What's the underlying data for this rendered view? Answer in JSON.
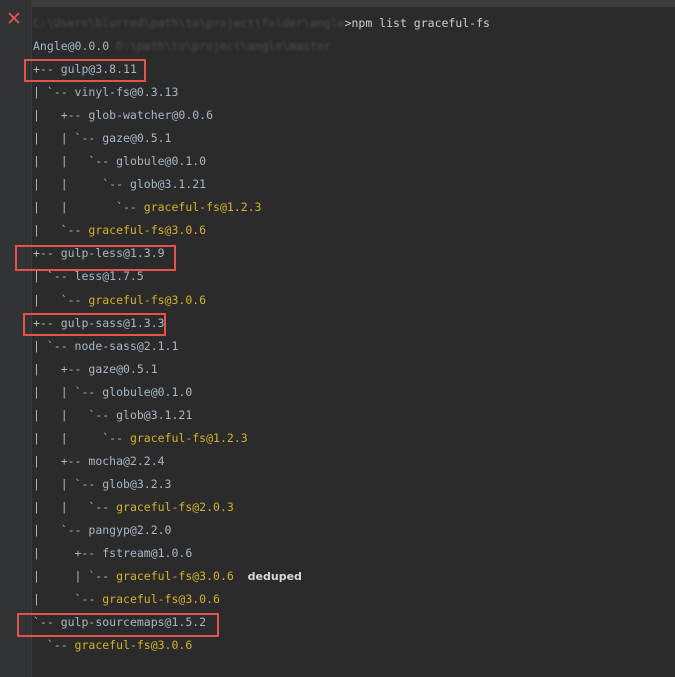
{
  "command": {
    "prompt_blurred": "C:\\Users\\blurred\\path\\to\\project\\folder\\angle",
    "text": ">npm list graceful-fs"
  },
  "root": {
    "package": "Angle@0.0.0",
    "path_blurred": "D:\\path\\to\\project\\angle\\master"
  },
  "tree": [
    {
      "prefix": "+-- ",
      "pkg": "gulp@3.8.11",
      "yellow": false
    },
    {
      "prefix": "| `-- ",
      "pkg": "vinyl-fs@0.3.13",
      "yellow": false
    },
    {
      "prefix": "|   +-- ",
      "pkg": "glob-watcher@0.0.6",
      "yellow": false
    },
    {
      "prefix": "|   | `-- ",
      "pkg": "gaze@0.5.1",
      "yellow": false
    },
    {
      "prefix": "|   |   `-- ",
      "pkg": "globule@0.1.0",
      "yellow": false
    },
    {
      "prefix": "|   |     `-- ",
      "pkg": "glob@3.1.21",
      "yellow": false
    },
    {
      "prefix": "|   |       `-- ",
      "pkg": "graceful-fs@1.2.3",
      "yellow": true
    },
    {
      "prefix": "|   `-- ",
      "pkg": "graceful-fs@3.0.6",
      "yellow": true
    },
    {
      "prefix": "+-- ",
      "pkg": "gulp-less@1.3.9",
      "yellow": false
    },
    {
      "prefix": "| `-- ",
      "pkg": "less@1.7.5",
      "yellow": false
    },
    {
      "prefix": "|   `-- ",
      "pkg": "graceful-fs@3.0.6",
      "yellow": true
    },
    {
      "prefix": "+-- ",
      "pkg": "gulp-sass@1.3.3",
      "yellow": false
    },
    {
      "prefix": "| `-- ",
      "pkg": "node-sass@2.1.1",
      "yellow": false
    },
    {
      "prefix": "|   +-- ",
      "pkg": "gaze@0.5.1",
      "yellow": false
    },
    {
      "prefix": "|   | `-- ",
      "pkg": "globule@0.1.0",
      "yellow": false
    },
    {
      "prefix": "|   |   `-- ",
      "pkg": "glob@3.1.21",
      "yellow": false
    },
    {
      "prefix": "|   |     `-- ",
      "pkg": "graceful-fs@1.2.3",
      "yellow": true
    },
    {
      "prefix": "|   +-- ",
      "pkg": "mocha@2.2.4",
      "yellow": false
    },
    {
      "prefix": "|   | `-- ",
      "pkg": "glob@3.2.3",
      "yellow": false
    },
    {
      "prefix": "|   |   `-- ",
      "pkg": "graceful-fs@2.0.3",
      "yellow": true
    },
    {
      "prefix": "|   `-- ",
      "pkg": "pangyp@2.2.0",
      "yellow": false
    },
    {
      "prefix": "|     +-- ",
      "pkg": "fstream@1.0.6",
      "yellow": false
    },
    {
      "prefix": "|     | `-- ",
      "pkg": "graceful-fs@3.0.6",
      "yellow": true,
      "suffix": "deduped"
    },
    {
      "prefix": "|     `-- ",
      "pkg": "graceful-fs@3.0.6",
      "yellow": true
    },
    {
      "prefix": "`-- ",
      "pkg": "gulp-sourcemaps@1.5.2",
      "yellow": false
    },
    {
      "prefix": "  `-- ",
      "pkg": "graceful-fs@3.0.6",
      "yellow": true
    }
  ],
  "highlighted": [
    "gulp@3.8.11",
    "gulp-less@1.3.9",
    "gulp-sass@1.3.3",
    "gulp-sourcemaps@1.5.2"
  ],
  "colors": {
    "background": "#2b2b2b",
    "text": "#a9b7c6",
    "highlight_pkg": "#d4b22a",
    "annotation_box": "#e5544b"
  },
  "icons": {
    "close": "close-icon"
  }
}
